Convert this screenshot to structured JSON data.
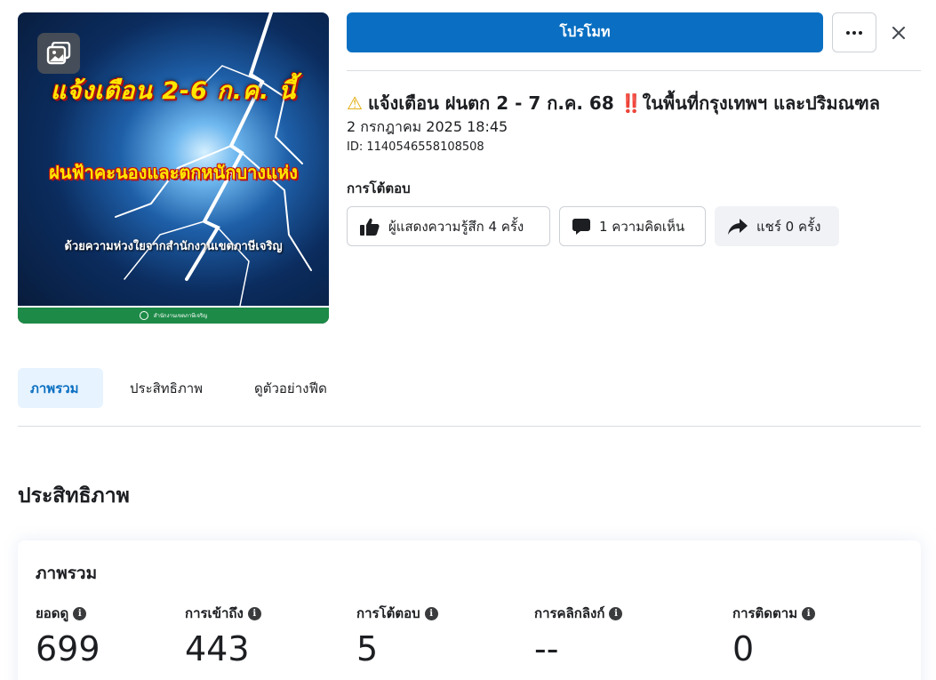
{
  "post_image": {
    "line1": "แจ้งเตือน 2-6 ก.ค. นี้",
    "line2": "ฝนฟ้าคะนองและตกหนักบางแห่ง",
    "line3": "ด้วยความห่วงใยจากสำนักงานเขตภาษีเจริญ",
    "footer": "สำนักงานเขตภาษีเจริญ",
    "album_icon": "photo-album-icon"
  },
  "header": {
    "promote_label": "โปรโมท",
    "more_icon": "more-options-icon",
    "close_icon": "close-icon"
  },
  "post": {
    "title": "แจ้งเตือน ฝนตก 2 - 7 ก.ค. 68 ‼️ในพื้นที่กรุงเทพฯ และปริมณฑล",
    "date": "2 กรกฎาคม 2025 18:45",
    "id": "ID: 1140546558108508"
  },
  "interactions": {
    "heading": "การโต้ตอบ",
    "likes": "ผู้แสดงความรู้สึก 4 ครั้ง",
    "comments": "1 ความคิดเห็น",
    "shares": "แชร์ 0 ครั้ง"
  },
  "tabs": [
    {
      "label": "ภาพรวม",
      "active": true
    },
    {
      "label": "ประสิทธิภาพ",
      "active": false
    },
    {
      "label": "ดูตัวอย่างฟีด",
      "active": false
    }
  ],
  "performance": {
    "section_title": "ประสิทธิภาพ",
    "card_title": "ภาพรวม",
    "metrics": [
      {
        "label": "ยอดดู",
        "value": "699"
      },
      {
        "label": "การเข้าถึง",
        "value": "443"
      },
      {
        "label": "การโต้ตอบ",
        "value": "5"
      },
      {
        "label": "การคลิกลิงก์",
        "value": "--"
      },
      {
        "label": "การติดตาม",
        "value": "0"
      }
    ]
  },
  "colors": {
    "primary": "#0a6fc2",
    "tab_active_bg": "#e7f3ff",
    "text": "#1c1e21",
    "border": "#ccd0d5"
  }
}
